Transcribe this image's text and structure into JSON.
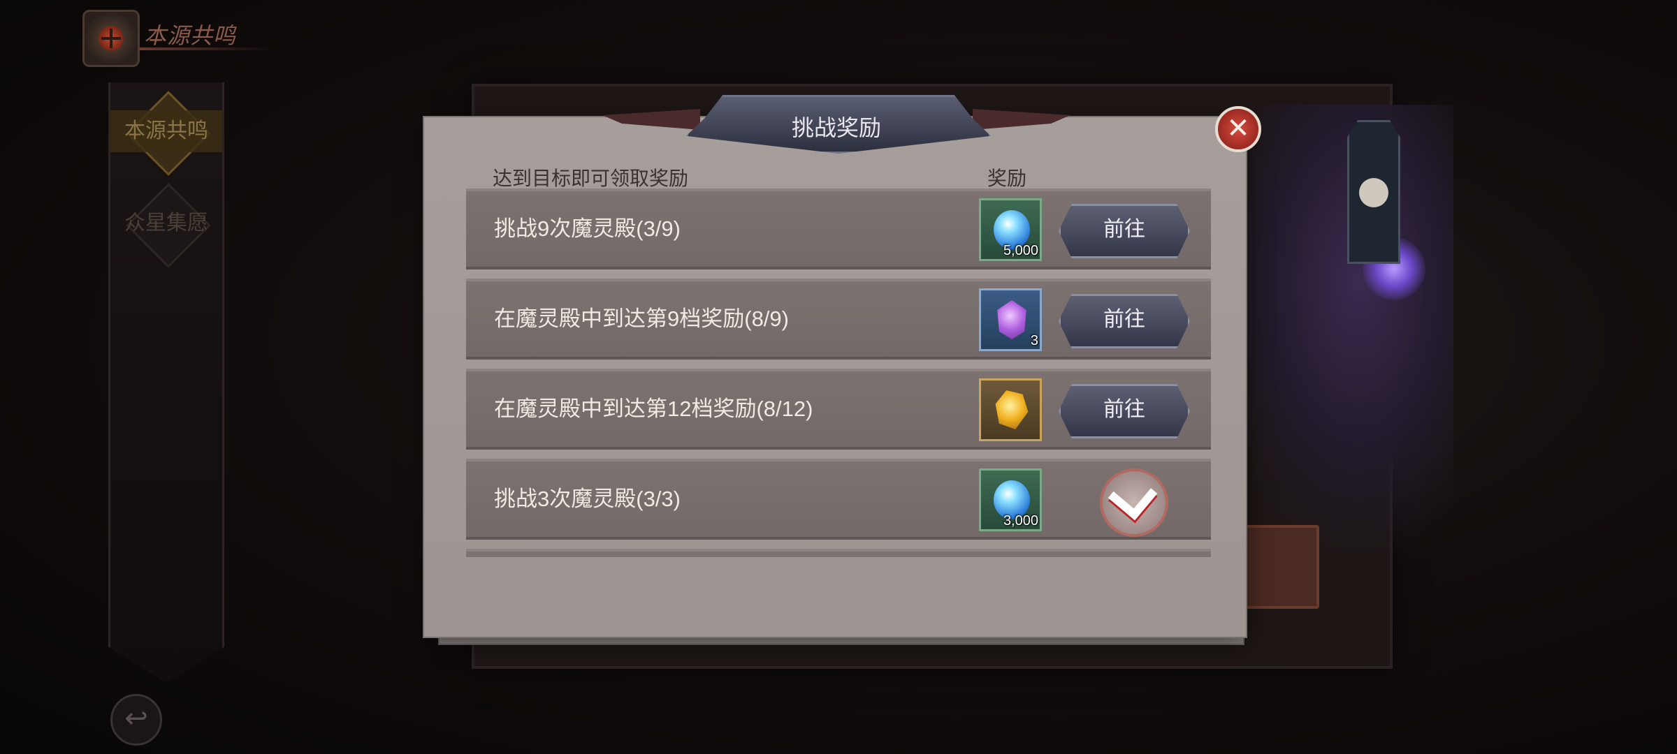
{
  "header": {
    "title": "本源共鸣"
  },
  "sidebar": {
    "items": [
      {
        "label": "本源共鸣",
        "active": true
      },
      {
        "label": "众星集愿",
        "active": false
      }
    ]
  },
  "dialog": {
    "title": "挑战奖励",
    "col_task": "达到目标即可领取奖励",
    "col_reward": "奖励",
    "rows": [
      {
        "label": "挑战9次魔灵殿(3/9)",
        "reward_icon": "blue-orb-icon",
        "reward_count": "5,000",
        "action": "前往",
        "completed": false
      },
      {
        "label": "在魔灵殿中到达第9档奖励(8/9)",
        "reward_icon": "purple-crystal-icon",
        "reward_count": "3",
        "action": "前往",
        "completed": false
      },
      {
        "label": "在魔灵殿中到达第12档奖励(8/12)",
        "reward_icon": "amber-crystal-icon",
        "reward_count": "",
        "action": "前往",
        "completed": false
      },
      {
        "label": "挑战3次魔灵殿(3/3)",
        "reward_icon": "blue-orb-icon",
        "reward_count": "3,000",
        "action": "",
        "completed": true
      },
      {
        "label": "",
        "reward_icon": "purple-crystal-icon",
        "reward_count": "",
        "action": "",
        "completed": true
      }
    ]
  },
  "colors": {
    "paper": "#a69e9b",
    "row": "#7c7270",
    "close": "#d84a3e",
    "button": "#34374a"
  }
}
